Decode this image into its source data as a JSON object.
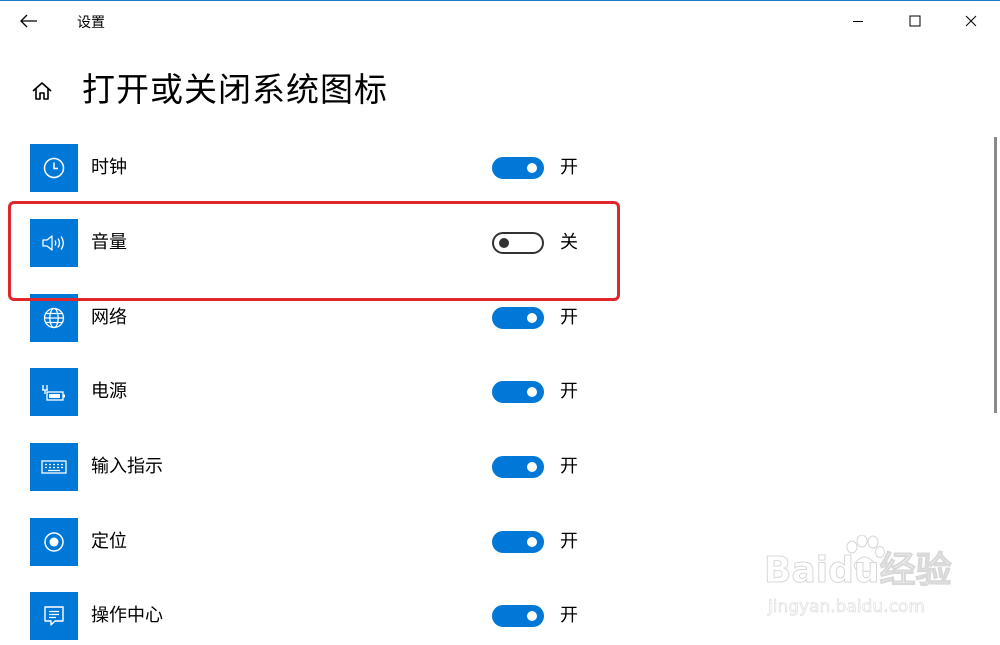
{
  "window": {
    "app_title": "设置",
    "accent_color": "#0078d7",
    "highlight_color": "#e0262d"
  },
  "header": {
    "title": "打开或关闭系统图标"
  },
  "items": [
    {
      "label": "时钟",
      "icon": "clock-icon",
      "state_label": "开",
      "on": true
    },
    {
      "label": "音量",
      "icon": "speaker-icon",
      "state_label": "关",
      "on": false
    },
    {
      "label": "网络",
      "icon": "globe-icon",
      "state_label": "开",
      "on": true
    },
    {
      "label": "电源",
      "icon": "battery-plug-icon",
      "state_label": "开",
      "on": true
    },
    {
      "label": "输入指示",
      "icon": "keyboard-icon",
      "state_label": "开",
      "on": true
    },
    {
      "label": "定位",
      "icon": "location-icon",
      "state_label": "开",
      "on": true
    },
    {
      "label": "操作中心",
      "icon": "action-center-icon",
      "state_label": "开",
      "on": true
    }
  ],
  "watermark": {
    "brand": "Baidu经验",
    "url": "jingyan.baidu.com"
  }
}
